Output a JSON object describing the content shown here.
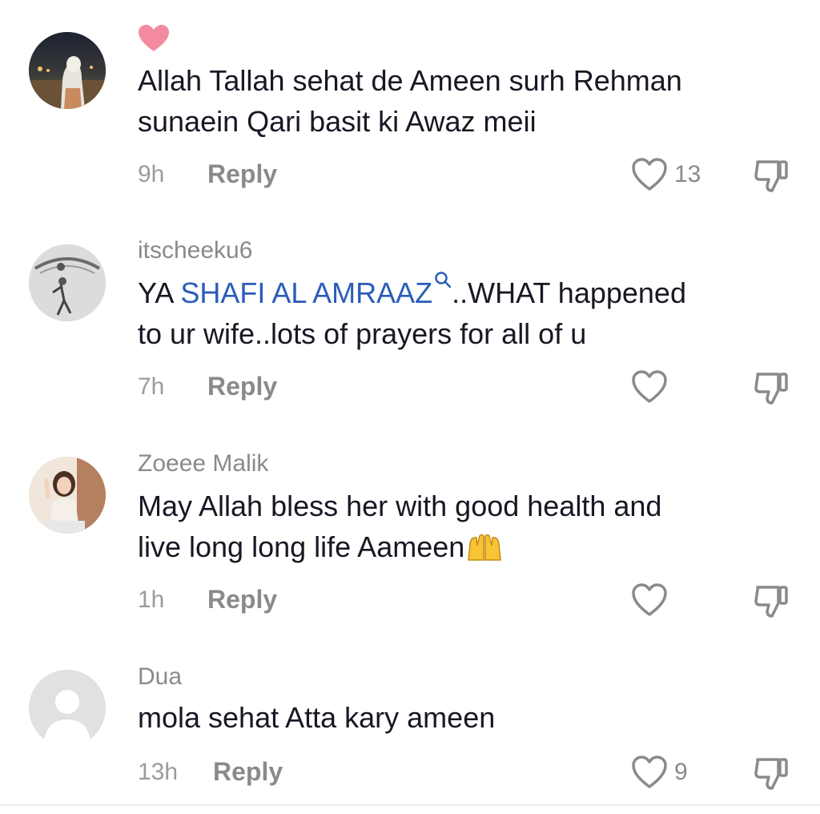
{
  "comments": [
    {
      "username": "",
      "avatar": "photo-woman-hijab-night",
      "badge": "heart-icon",
      "text_parts": [
        "Allah Tallah sehat de Ameen surh Rehman",
        "sunaein Qari basit ki Awaz meii"
      ],
      "time": "9h",
      "reply_label": "Reply",
      "like_count": "13"
    },
    {
      "username": "itscheeku6",
      "avatar": "sketch-drawing",
      "text_prefix": "YA ",
      "mention": "SHAFI AL AMRAAZ",
      "text_after_mention": "..WHAT happened",
      "text_line2": "to ur wife..lots of prayers for all of u",
      "time": "7h",
      "reply_label": "Reply",
      "like_count": ""
    },
    {
      "username": "Zoeee Malik",
      "avatar": "photo-girl-peace-sign",
      "text_line1": "May Allah bless her with good health and",
      "text_line2": "live long long life Aameen",
      "emoji": "praying-hands-emoji",
      "time": "1h",
      "reply_label": "Reply",
      "like_count": ""
    },
    {
      "username": "Dua",
      "avatar": "default-avatar",
      "text_line1": "mola sehat Atta kary ameen",
      "time": "13h",
      "reply_label": "Reply",
      "like_count": "9"
    }
  ],
  "colors": {
    "text": "#161823",
    "muted": "#8a8a8a",
    "mention": "#2b5db8",
    "badge": "#f48aa0"
  }
}
